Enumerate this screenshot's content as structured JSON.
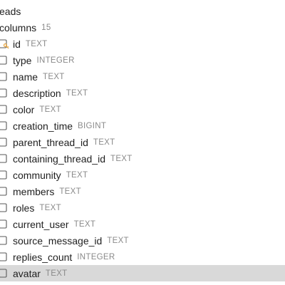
{
  "table": {
    "name": "eads"
  },
  "columns_folder": {
    "label": "columns",
    "count": "15"
  },
  "columns": [
    {
      "name": "id",
      "type": "TEXT",
      "icon": "primary-key-column-icon"
    },
    {
      "name": "type",
      "type": "INTEGER",
      "icon": "column-icon"
    },
    {
      "name": "name",
      "type": "TEXT",
      "icon": "column-icon"
    },
    {
      "name": "description",
      "type": "TEXT",
      "icon": "column-icon"
    },
    {
      "name": "color",
      "type": "TEXT",
      "icon": "column-icon"
    },
    {
      "name": "creation_time",
      "type": "BIGINT",
      "icon": "column-icon"
    },
    {
      "name": "parent_thread_id",
      "type": "TEXT",
      "icon": "column-icon"
    },
    {
      "name": "containing_thread_id",
      "type": "TEXT",
      "icon": "column-icon"
    },
    {
      "name": "community",
      "type": "TEXT",
      "icon": "column-icon"
    },
    {
      "name": "members",
      "type": "TEXT",
      "icon": "column-icon"
    },
    {
      "name": "roles",
      "type": "TEXT",
      "icon": "column-icon"
    },
    {
      "name": "current_user",
      "type": "TEXT",
      "icon": "column-icon"
    },
    {
      "name": "source_message_id",
      "type": "TEXT",
      "icon": "column-icon"
    },
    {
      "name": "replies_count",
      "type": "INTEGER",
      "icon": "column-icon"
    },
    {
      "name": "avatar",
      "type": "TEXT",
      "icon": "column-icon",
      "selected": true
    }
  ],
  "colors": {
    "selection": "#d9d9d9",
    "type_text": "#8a8a8a",
    "key_accent": "#e8a33a"
  }
}
